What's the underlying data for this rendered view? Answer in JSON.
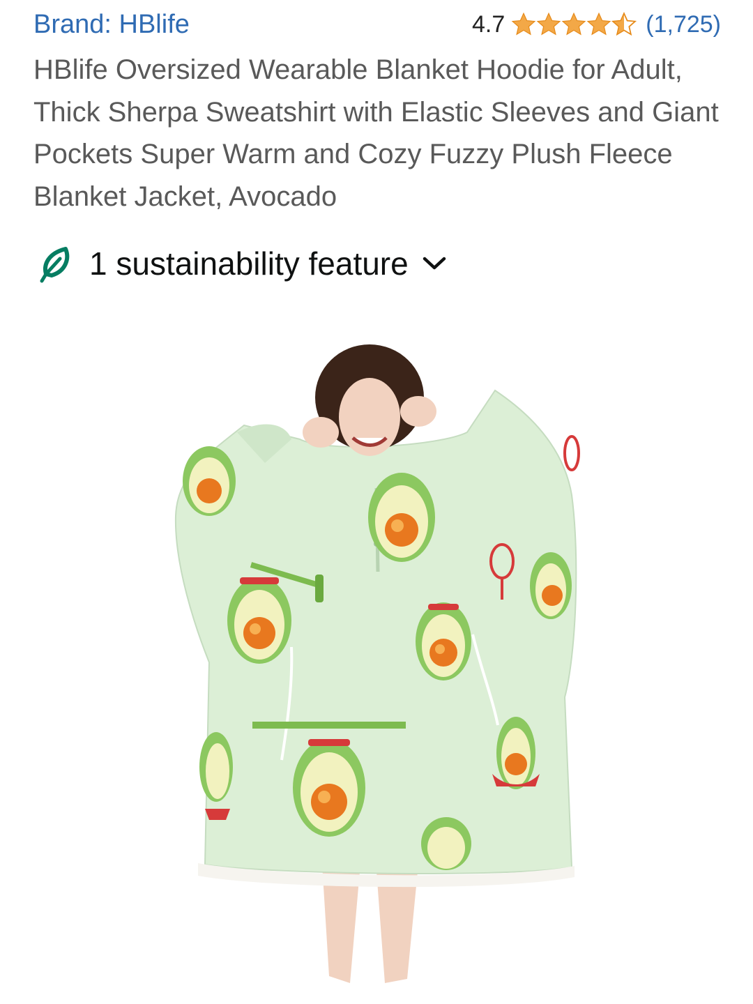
{
  "brand": {
    "label": "Brand: HBlife"
  },
  "rating": {
    "value": "4.7",
    "stars": 4.5,
    "count": "(1,725)",
    "color": "#f3a847"
  },
  "product": {
    "title": "HBlife Oversized Wearable Blanket Hoodie for Adult, Thick Sherpa Sweatshirt with Elastic Sleeves and Giant Pockets Super Warm and Cozy Fuzzy Plush Fleece Blanket Jacket, Avocado"
  },
  "sustainability": {
    "label": "1 sustainability feature",
    "icon": "leaf-icon",
    "chevron": "chevron-down-icon",
    "color": "#067d62"
  },
  "colors": {
    "link": "#2f6bb3",
    "title": "#595959",
    "hoodie": "#dcefd6"
  }
}
